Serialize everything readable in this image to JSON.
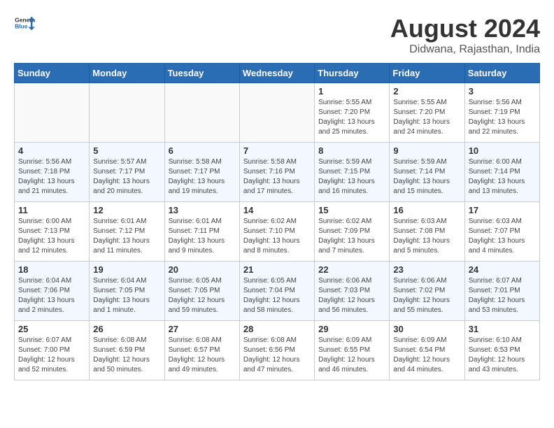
{
  "header": {
    "logo_general": "General",
    "logo_blue": "Blue",
    "month_year": "August 2024",
    "location": "Didwana, Rajasthan, India"
  },
  "weekdays": [
    "Sunday",
    "Monday",
    "Tuesday",
    "Wednesday",
    "Thursday",
    "Friday",
    "Saturday"
  ],
  "weeks": [
    [
      {
        "day": "",
        "info": ""
      },
      {
        "day": "",
        "info": ""
      },
      {
        "day": "",
        "info": ""
      },
      {
        "day": "",
        "info": ""
      },
      {
        "day": "1",
        "info": "Sunrise: 5:55 AM\nSunset: 7:20 PM\nDaylight: 13 hours and 25 minutes."
      },
      {
        "day": "2",
        "info": "Sunrise: 5:55 AM\nSunset: 7:20 PM\nDaylight: 13 hours and 24 minutes."
      },
      {
        "day": "3",
        "info": "Sunrise: 5:56 AM\nSunset: 7:19 PM\nDaylight: 13 hours and 22 minutes."
      }
    ],
    [
      {
        "day": "4",
        "info": "Sunrise: 5:56 AM\nSunset: 7:18 PM\nDaylight: 13 hours and 21 minutes."
      },
      {
        "day": "5",
        "info": "Sunrise: 5:57 AM\nSunset: 7:17 PM\nDaylight: 13 hours and 20 minutes."
      },
      {
        "day": "6",
        "info": "Sunrise: 5:58 AM\nSunset: 7:17 PM\nDaylight: 13 hours and 19 minutes."
      },
      {
        "day": "7",
        "info": "Sunrise: 5:58 AM\nSunset: 7:16 PM\nDaylight: 13 hours and 17 minutes."
      },
      {
        "day": "8",
        "info": "Sunrise: 5:59 AM\nSunset: 7:15 PM\nDaylight: 13 hours and 16 minutes."
      },
      {
        "day": "9",
        "info": "Sunrise: 5:59 AM\nSunset: 7:14 PM\nDaylight: 13 hours and 15 minutes."
      },
      {
        "day": "10",
        "info": "Sunrise: 6:00 AM\nSunset: 7:14 PM\nDaylight: 13 hours and 13 minutes."
      }
    ],
    [
      {
        "day": "11",
        "info": "Sunrise: 6:00 AM\nSunset: 7:13 PM\nDaylight: 13 hours and 12 minutes."
      },
      {
        "day": "12",
        "info": "Sunrise: 6:01 AM\nSunset: 7:12 PM\nDaylight: 13 hours and 11 minutes."
      },
      {
        "day": "13",
        "info": "Sunrise: 6:01 AM\nSunset: 7:11 PM\nDaylight: 13 hours and 9 minutes."
      },
      {
        "day": "14",
        "info": "Sunrise: 6:02 AM\nSunset: 7:10 PM\nDaylight: 13 hours and 8 minutes."
      },
      {
        "day": "15",
        "info": "Sunrise: 6:02 AM\nSunset: 7:09 PM\nDaylight: 13 hours and 7 minutes."
      },
      {
        "day": "16",
        "info": "Sunrise: 6:03 AM\nSunset: 7:08 PM\nDaylight: 13 hours and 5 minutes."
      },
      {
        "day": "17",
        "info": "Sunrise: 6:03 AM\nSunset: 7:07 PM\nDaylight: 13 hours and 4 minutes."
      }
    ],
    [
      {
        "day": "18",
        "info": "Sunrise: 6:04 AM\nSunset: 7:06 PM\nDaylight: 13 hours and 2 minutes."
      },
      {
        "day": "19",
        "info": "Sunrise: 6:04 AM\nSunset: 7:05 PM\nDaylight: 13 hours and 1 minute."
      },
      {
        "day": "20",
        "info": "Sunrise: 6:05 AM\nSunset: 7:05 PM\nDaylight: 12 hours and 59 minutes."
      },
      {
        "day": "21",
        "info": "Sunrise: 6:05 AM\nSunset: 7:04 PM\nDaylight: 12 hours and 58 minutes."
      },
      {
        "day": "22",
        "info": "Sunrise: 6:06 AM\nSunset: 7:03 PM\nDaylight: 12 hours and 56 minutes."
      },
      {
        "day": "23",
        "info": "Sunrise: 6:06 AM\nSunset: 7:02 PM\nDaylight: 12 hours and 55 minutes."
      },
      {
        "day": "24",
        "info": "Sunrise: 6:07 AM\nSunset: 7:01 PM\nDaylight: 12 hours and 53 minutes."
      }
    ],
    [
      {
        "day": "25",
        "info": "Sunrise: 6:07 AM\nSunset: 7:00 PM\nDaylight: 12 hours and 52 minutes."
      },
      {
        "day": "26",
        "info": "Sunrise: 6:08 AM\nSunset: 6:59 PM\nDaylight: 12 hours and 50 minutes."
      },
      {
        "day": "27",
        "info": "Sunrise: 6:08 AM\nSunset: 6:57 PM\nDaylight: 12 hours and 49 minutes."
      },
      {
        "day": "28",
        "info": "Sunrise: 6:08 AM\nSunset: 6:56 PM\nDaylight: 12 hours and 47 minutes."
      },
      {
        "day": "29",
        "info": "Sunrise: 6:09 AM\nSunset: 6:55 PM\nDaylight: 12 hours and 46 minutes."
      },
      {
        "day": "30",
        "info": "Sunrise: 6:09 AM\nSunset: 6:54 PM\nDaylight: 12 hours and 44 minutes."
      },
      {
        "day": "31",
        "info": "Sunrise: 6:10 AM\nSunset: 6:53 PM\nDaylight: 12 hours and 43 minutes."
      }
    ]
  ]
}
